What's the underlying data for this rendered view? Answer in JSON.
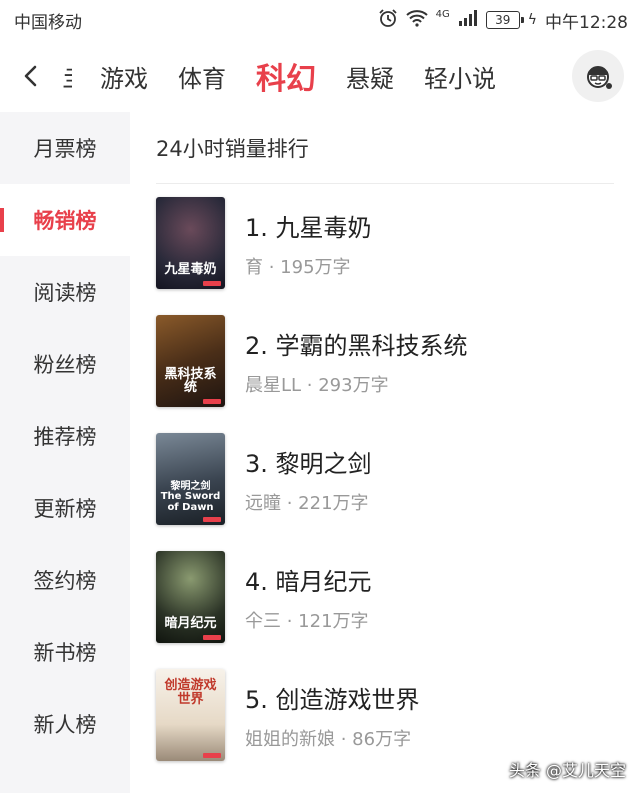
{
  "status_bar": {
    "carrier": "中国移动",
    "network": "4G",
    "battery": "39",
    "time": "中午12:28"
  },
  "nav": {
    "tabs": [
      "亖",
      "游戏",
      "体育",
      "科幻",
      "悬疑",
      "轻小说"
    ],
    "active_tab": "科幻"
  },
  "sidebar": {
    "items": [
      "月票榜",
      "畅销榜",
      "阅读榜",
      "粉丝榜",
      "推荐榜",
      "更新榜",
      "签约榜",
      "新书榜",
      "新人榜"
    ],
    "active_item": "畅销榜"
  },
  "section_title": "24小时销量排行",
  "books": [
    {
      "rank_title": "1. 九星毒奶",
      "meta": "育 · 195万字",
      "cover_text": "九星毒奶",
      "cover_color": "#2a2a3a"
    },
    {
      "rank_title": "2. 学霸的黑科技系统",
      "meta": "晨星LL · 293万字",
      "cover_text": "黑科技系统",
      "cover_color": "#5a3a1e"
    },
    {
      "rank_title": "3. 黎明之剑",
      "meta": "远瞳 · 221万字",
      "cover_text": "黎明之剑 The Sword of Dawn",
      "cover_color": "#3a4450"
    },
    {
      "rank_title": "4. 暗月纪元",
      "meta": "仐三 · 121万字",
      "cover_text": "暗月纪元",
      "cover_color": "#2b3326"
    },
    {
      "rank_title": "5. 创造游戏世界",
      "meta": "姐姐的新娘 · 86万字",
      "cover_text": "创造游戏世界",
      "cover_color": "#f3ede4"
    }
  ],
  "watermark": "头条 @艾儿天空",
  "colors": {
    "accent": "#e8404b",
    "sidebar_bg": "#f5f5f7"
  }
}
